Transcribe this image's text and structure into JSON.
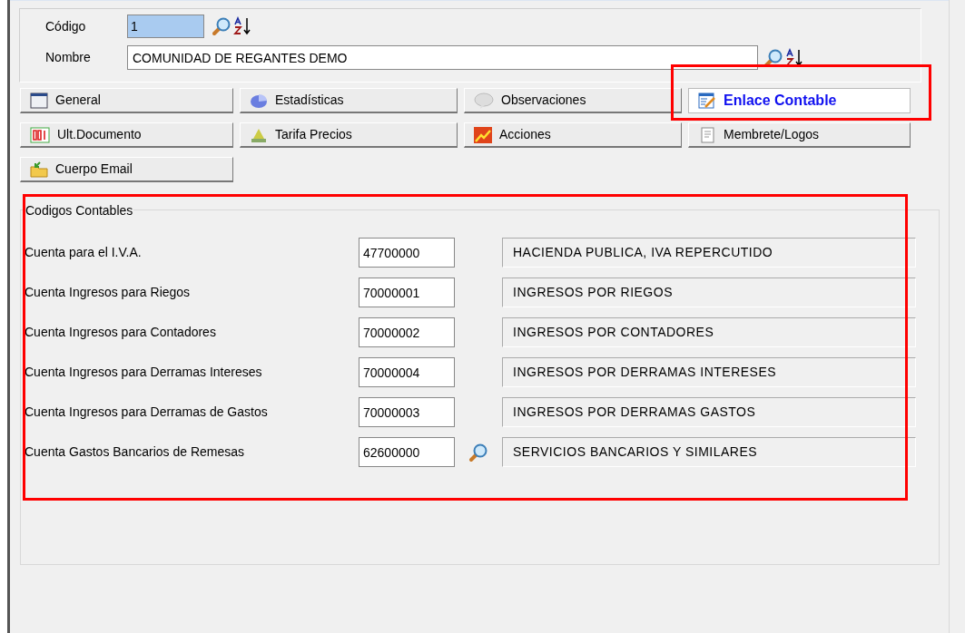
{
  "header": {
    "codigo": {
      "label": "Código",
      "value": "1"
    },
    "nombre": {
      "label": "Nombre",
      "value": "COMUNIDAD DE REGANTES DEMO"
    }
  },
  "tabs": [
    {
      "label": "General",
      "selected": false
    },
    {
      "label": "Estadísticas",
      "selected": false
    },
    {
      "label": "Observaciones",
      "selected": false
    },
    {
      "label": "Enlace Contable",
      "selected": true
    },
    {
      "label": "Ult.Documento",
      "selected": false
    },
    {
      "label": "Tarifa Precios",
      "selected": false
    },
    {
      "label": "Acciones",
      "selected": false
    },
    {
      "label": "Membrete/Logos",
      "selected": false
    },
    {
      "label": "Cuerpo Email",
      "selected": false
    }
  ],
  "group": {
    "title": "Codigos Contables",
    "rows": [
      {
        "label": "Cuenta para el I.V.A.",
        "code": "47700000",
        "description": "HACIENDA PUBLICA, IVA REPERCUTIDO",
        "lookup": false
      },
      {
        "label": "Cuenta Ingresos para Riegos",
        "code": "70000001",
        "description": "INGRESOS POR RIEGOS",
        "lookup": false
      },
      {
        "label": "Cuenta Ingresos para Contadores",
        "code": "70000002",
        "description": "INGRESOS POR CONTADORES",
        "lookup": false
      },
      {
        "label": "Cuenta Ingresos para Derramas Intereses",
        "code": "70000004",
        "description": "INGRESOS POR DERRAMAS INTERESES",
        "lookup": false
      },
      {
        "label": "Cuenta Ingresos para Derramas de Gastos",
        "code": "70000003",
        "description": "INGRESOS POR DERRAMAS GASTOS",
        "lookup": false
      },
      {
        "label": "Cuenta Gastos Bancarios de Remesas",
        "code": "62600000",
        "description": "SERVICIOS BANCARIOS Y SIMILARES",
        "lookup": true
      }
    ]
  }
}
